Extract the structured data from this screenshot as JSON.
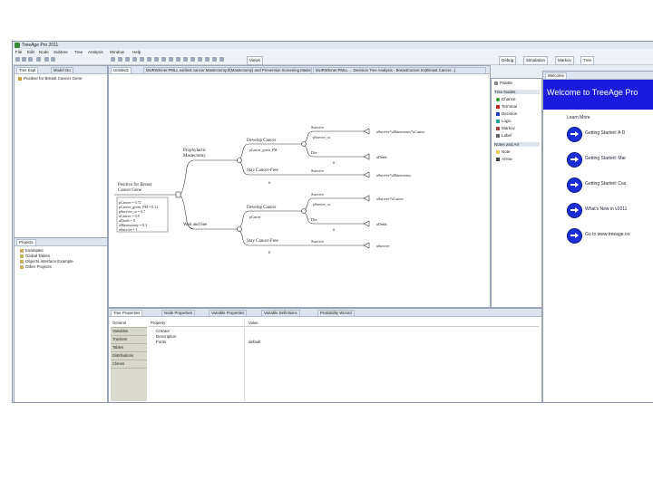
{
  "window": {
    "title": "TreeAge Pro 2011"
  },
  "menu": [
    "File",
    "Edit",
    "Node",
    "Subtree",
    "Tree",
    "Analysis",
    "Window",
    "Help"
  ],
  "perspectives": {
    "views": "Views",
    "debug": "Debug",
    "simulation": "Simulation",
    "markov": "Markov",
    "tree": "Tree"
  },
  "left_panel": {
    "tabs": [
      "Tree Expl",
      "Model Ou"
    ],
    "items": [
      "Positive for Breast Cancer Gene"
    ]
  },
  "projects_panel": {
    "tab": "Projects",
    "items": [
      "Examples",
      "Global Tables",
      "Objects Interface Example",
      "Other Projects"
    ]
  },
  "editor": {
    "tabs": [
      "Untitled1",
      "MURWInner.PMLL earliest cancer Mastectomy.tf(Mastectomy) and Prevention Screening Mastectomy",
      "MURWInner.PMLL ... Decision Tree Analysis - BreastCancer.trx(Breast Cancer...)"
    ],
    "tree": {
      "root": "Positive for Breast Cancer Gene",
      "root_vars": [
        "pCancer = 0.72",
        "pCancer_given_PM = 0.12",
        "pSurvive_ca = 0.7",
        "uCancer = 0.8",
        "uDeath = 0",
        "uMastectomy = 0.3",
        "uSurvive = 1"
      ],
      "dec1": "Prophylactic Mastectomy",
      "dec2": "Wait and See",
      "dev_cancer": "Develop Cancer",
      "stay_free": "Stay Cancer-Free",
      "survive": "Survive",
      "die": "Die",
      "psurvive_ca": "pSurvive_ca",
      "pcancer_given_pm": "pCancer_given_PM",
      "pcancer": "pCancer",
      "hash": "#",
      "pay1": "uSurvive*uMastectomy*uCancer",
      "pay2": "uDeath",
      "pay3": "uSurvive*uMastectomy",
      "pay4": "uSurvive*uCancer",
      "pay5": "uDeath",
      "pay6": "uSurvive"
    }
  },
  "palette": {
    "header": "Palette",
    "group1": "Tree Nodes",
    "nodes": [
      {
        "label": "Chance",
        "color": "#2a9a2a"
      },
      {
        "label": "Terminal",
        "color": "#c02020"
      },
      {
        "label": "Decision",
        "color": "#2040c0"
      },
      {
        "label": "Logic",
        "color": "#20a0a0"
      },
      {
        "label": "Markov",
        "color": "#a04040"
      },
      {
        "label": "Label",
        "color": "#606060"
      }
    ],
    "group2": "Notes and Arr",
    "notes": [
      "Note",
      "Arrow"
    ]
  },
  "welcome": {
    "tab": "Welcome",
    "header": "Welcome to TreeAge Pro",
    "learn_more": "Learn More",
    "links": [
      "Getting Started: A D",
      "Getting Started: Mar",
      "Getting Started: Cos",
      "What's New in v2011",
      "Go to www.treeage.co"
    ]
  },
  "bottom": {
    "tabs": [
      "Tree Properties",
      "Node Properties",
      "Variable Properties",
      "Variable Definitions",
      "Probability Wizard"
    ],
    "side_tabs": [
      "General",
      "Variables",
      "Trackers",
      "Tables",
      "Distributions",
      "Clones"
    ],
    "headers": {
      "property": "Property",
      "value": "Value"
    },
    "rows": [
      {
        "property": "Creator",
        "value": ""
      },
      {
        "property": "Description",
        "value": ""
      },
      {
        "property": "Fonts",
        "value": "default"
      }
    ]
  }
}
